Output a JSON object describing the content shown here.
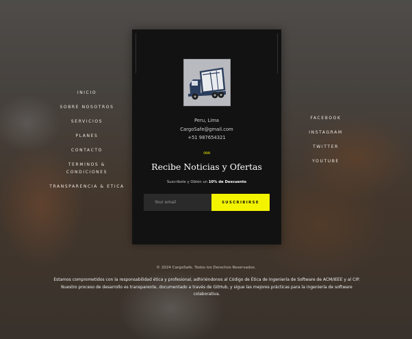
{
  "nav_left": [
    "INICIO",
    "SOBRE NOSOTROS",
    "SERVICIOS",
    "PLANES",
    "CONTACTO",
    "TERMINOS & CONDICIONES",
    "TRANSPARENCIA & ETICA"
  ],
  "nav_right": [
    "FACEBOOK",
    "INSTAGRAM",
    "TWITTER",
    "YOUTUBE"
  ],
  "logo": {
    "icon": "truck-logo-icon"
  },
  "contact": {
    "location": "Peru, Lima",
    "email": "CargoSafe@gmail.com",
    "phone": "+51 987654321"
  },
  "divider_icon": "ooo",
  "newsletter": {
    "title": "Recibe Noticias y Ofertas",
    "subtitle_prefix": "Suscribete y Obtén un ",
    "subtitle_highlight": "10% de Descuento",
    "email_placeholder": "Your email",
    "subscribe_label": "SUSCRIBIRSE"
  },
  "footer": {
    "copyright": "© 2024 CargoSafe. Todos los Derechos Reservados.",
    "ethics": "Estamos comprometidos con la responsabilidad ética y profesional, adhiriéndonos al Código de Ética de Ingeniería de Software de ACM/IEEE y al CIP. Nuestro proceso de desarrollo es transparente, documentado a través de GitHub, y sigue las mejores prácticas para la ingeniería de software colaborativa."
  },
  "colors": {
    "accent": "#f3f300",
    "panel": "#121212"
  }
}
